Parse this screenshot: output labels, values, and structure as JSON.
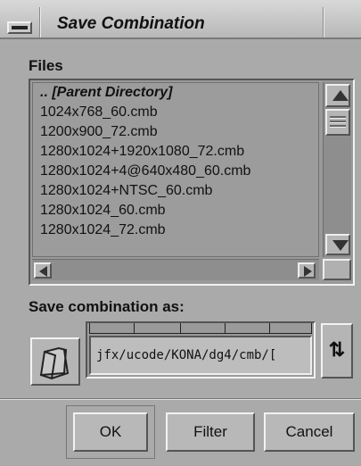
{
  "window": {
    "title": "Save Combination"
  },
  "files": {
    "label": "Files",
    "items": [
      ".. [Parent Directory]",
      "1024x768_60.cmb",
      "1200x900_72.cmb",
      "1280x1024+1920x1080_72.cmb",
      "1280x1024+4@640x480_60.cmb",
      "1280x1024+NTSC_60.cmb",
      "1280x1024_60.cmb",
      "1280x1024_72.cmb"
    ]
  },
  "save": {
    "label": "Save combination as:",
    "path_value": "jfx/ucode/KONA/dg4/cmb/["
  },
  "icons": {
    "window_menu": "window-menu-icon",
    "folder": "folder-icon",
    "swap": "swap-arrows-icon",
    "swap_glyph": "⇅"
  },
  "buttons": {
    "ok": "OK",
    "filter": "Filter",
    "cancel": "Cancel"
  }
}
